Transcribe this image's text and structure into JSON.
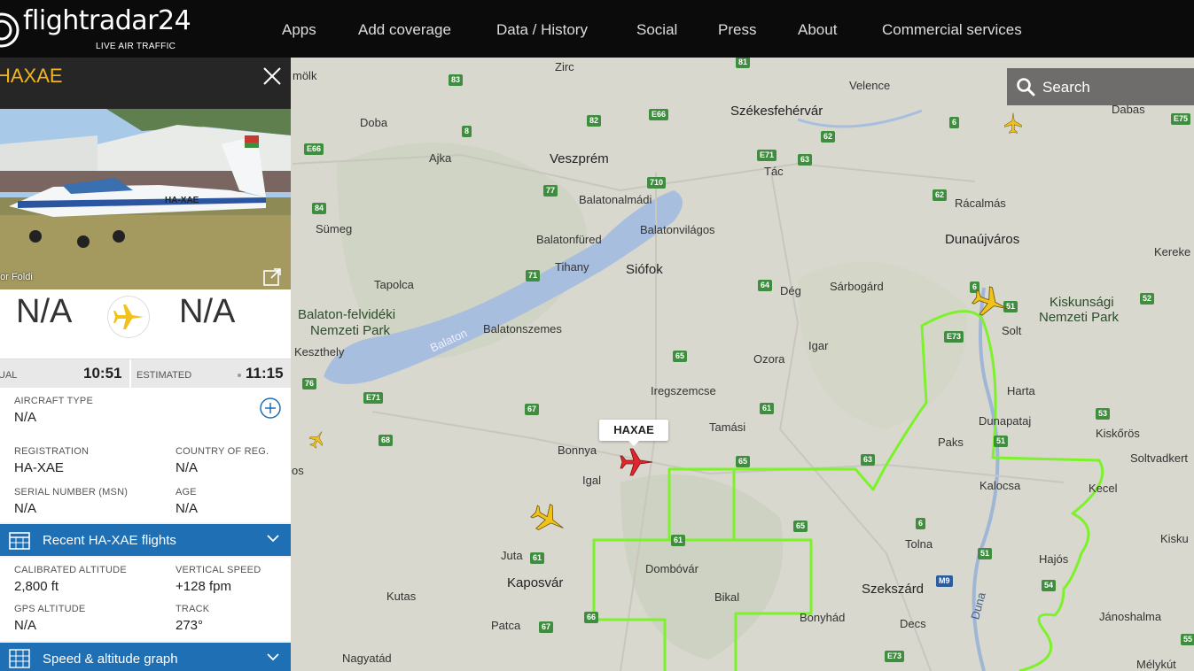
{
  "brand": {
    "name": "flightradar24",
    "tagline": "LIVE AIR TRAFFIC"
  },
  "nav": [
    "Apps",
    "Add coverage",
    "Data / History",
    "Social",
    "Press",
    "About",
    "Commercial services"
  ],
  "search": {
    "label": "Search"
  },
  "panel": {
    "title": "HAXAE",
    "photo_credit": "bor Foldi",
    "aircraft_reg_on_photo": "HA-XAE",
    "origin": "N/A",
    "destination": "N/A",
    "actual_label": "UAL",
    "actual_time": "10:51",
    "estimated_label": "ESTIMATED",
    "estimated_time": "11:15",
    "aircraft_type_label": "AIRCRAFT TYPE",
    "aircraft_type": "N/A",
    "registration_label": "REGISTRATION",
    "registration": "HA-XAE",
    "country_label": "COUNTRY OF REG.",
    "country": "N/A",
    "serial_label": "SERIAL NUMBER (MSN)",
    "serial": "N/A",
    "age_label": "AGE",
    "age": "N/A",
    "recent_flights_label": "Recent HA-XAE flights",
    "cal_alt_label": "CALIBRATED ALTITUDE",
    "cal_alt": "2,800 ft",
    "vspeed_label": "VERTICAL SPEED",
    "vspeed": "+128 fpm",
    "gps_alt_label": "GPS ALTITUDE",
    "gps_alt": "N/A",
    "track_label": "TRACK",
    "track": "273°",
    "speed_graph_label": "Speed & altitude graph"
  },
  "map": {
    "selected_callsign": "HAXAE",
    "lake_label": "Balaton",
    "towns": [
      "Zirc",
      "mölk",
      "Velence",
      "Székesfehérvár",
      "Dabas",
      "Doba",
      "Ajka",
      "Veszprém",
      "Tác",
      "Balatonalmádi",
      "Sümeg",
      "Balatonfüred",
      "Balatonvilágos",
      "Rácalmás",
      "Dunaújváros",
      "Kereke",
      "Tihany",
      "Siófok",
      "Tapolca",
      "Dég",
      "Sárbogárd",
      "Balaton-felvidéki",
      "Nemzeti Park",
      "Kiskunsági",
      "Nemzeti Park",
      "Solt",
      "Balatonszemes",
      "Igar",
      "Keszthely",
      "Ozora",
      "Iregszemcse",
      "Harta",
      "Tamási",
      "Dunapataj",
      "Kiskőrös",
      "Paks",
      "Bonnya",
      "Soltvadkert",
      "Igal",
      "Kalocsa",
      "Kecel",
      "Tolna",
      "Juta",
      "Kaposvár",
      "Dombóvár",
      "Hajós",
      "Kisku",
      "Kutas",
      "Szekszárd",
      "Bikal",
      "Bonyhád",
      "Jánoshalma",
      "Patca",
      "Decs",
      "Nagyatád",
      "Mélykút",
      "Duna",
      "os"
    ],
    "roads": [
      "81",
      "83",
      "E66",
      "82",
      "8",
      "E66",
      "E71",
      "62",
      "63",
      "6",
      "E75",
      "710",
      "77",
      "62",
      "84",
      "71",
      "64",
      "6",
      "51",
      "E73",
      "52",
      "65",
      "76",
      "E71",
      "67",
      "61",
      "68",
      "63",
      "65",
      "51",
      "53",
      "61",
      "65",
      "6",
      "51",
      "61",
      "M9",
      "54",
      "67",
      "66",
      "E73",
      "55"
    ]
  },
  "colors": {
    "accent": "#f3b51e",
    "track": "#7cf22a",
    "section": "#1f6fb5",
    "selected_plane": "#e0262e"
  }
}
